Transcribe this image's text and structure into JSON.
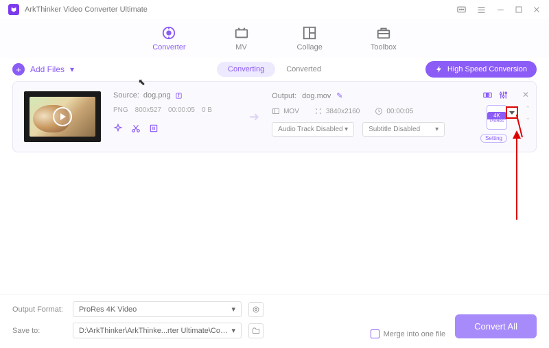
{
  "title": "ArkThinker Video Converter Ultimate",
  "tabs": {
    "converter": "Converter",
    "mv": "MV",
    "collage": "Collage",
    "toolbox": "Toolbox"
  },
  "toolbar": {
    "addFiles": "Add Files",
    "converting": "Converting",
    "converted": "Converted",
    "hsc": "High Speed Conversion"
  },
  "item": {
    "sourceLabel": "Source:",
    "sourceFile": "dog.png",
    "srcFormat": "PNG",
    "srcRes": "800x527",
    "srcDur": "00:00:05",
    "srcSize": "0 B",
    "outputLabel": "Output:",
    "outputFile": "dog.mov",
    "outFormat": "MOV",
    "outRes": "3840x2160",
    "outDur": "00:00:05",
    "audioSel": "Audio Track Disabled",
    "subSel": "Subtitle Disabled",
    "badge4k": "4K",
    "badgeApple": "",
    "badgePR": "ProRes",
    "setting": "Setting"
  },
  "bottom": {
    "outputFormatLabel": "Output Format:",
    "outputFormat": "ProRes 4K Video",
    "saveToLabel": "Save to:",
    "saveTo": "D:\\ArkThinker\\ArkThinke...rter Ultimate\\Converted",
    "merge": "Merge into one file",
    "convert": "Convert All"
  }
}
